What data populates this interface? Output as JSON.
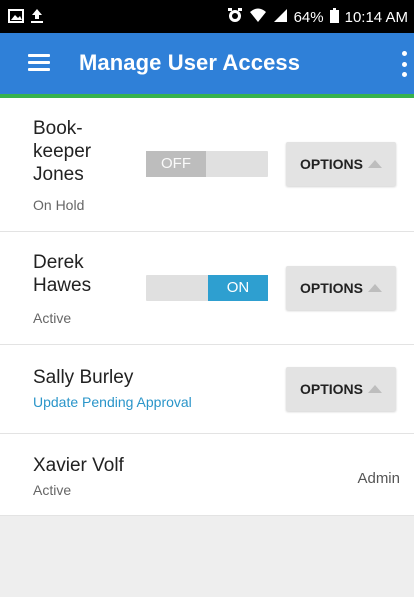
{
  "status_bar": {
    "battery": "64%",
    "time": "10:14 AM"
  },
  "app_bar": {
    "title": "Manage User Access"
  },
  "users": [
    {
      "name": "Book-keeper Jones",
      "status": "On Hold",
      "toggle_label": "OFF",
      "toggle_state": "off",
      "options_label": "OPTIONS"
    },
    {
      "name": "Derek Hawes",
      "status": "Active",
      "toggle_label": "ON",
      "toggle_state": "on",
      "options_label": "OPTIONS"
    },
    {
      "name": "Sally Burley",
      "status": "Update Pending Approval",
      "options_label": "OPTIONS"
    },
    {
      "name": "Xavier Volf",
      "status": "Active",
      "role": "Admin"
    }
  ],
  "colors": {
    "app_bar": "#2f80d8",
    "accent_line": "#37b24d",
    "toggle_on": "#2e9fd0",
    "pending_text": "#2a95c9"
  },
  "icons": {
    "status_left": [
      "image-icon",
      "upload-icon"
    ],
    "status_right": [
      "alarm-icon",
      "wifi-icon",
      "signal-icon",
      "battery-icon"
    ],
    "app_bar": [
      "menu-icon",
      "more-vertical-icon"
    ],
    "options": "caret-up-icon"
  }
}
